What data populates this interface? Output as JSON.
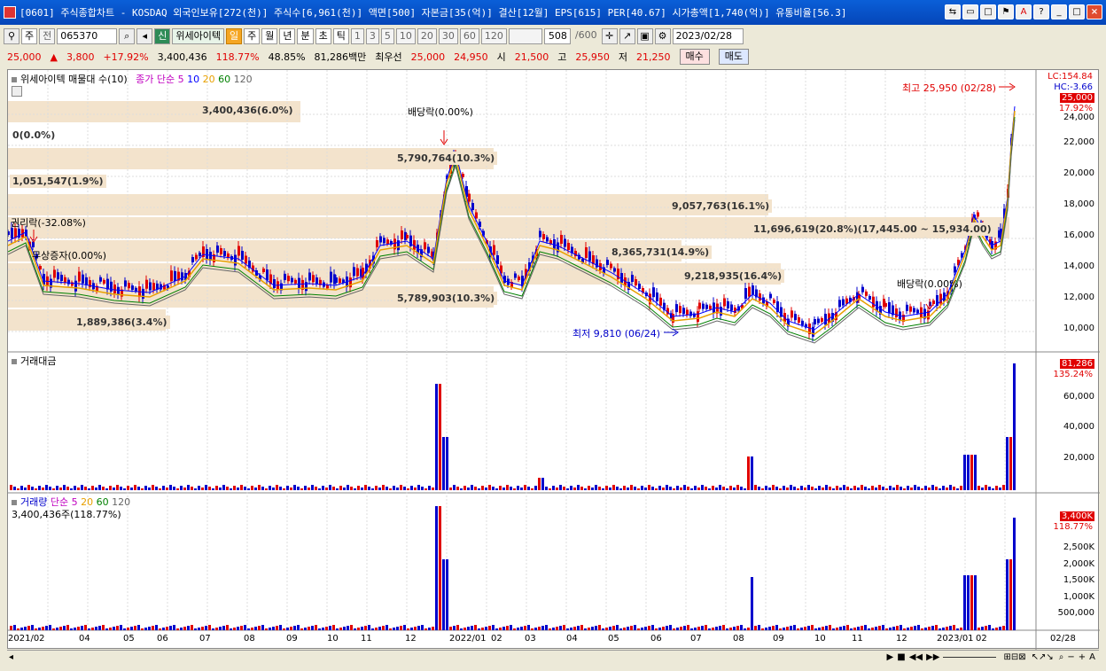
{
  "window": {
    "title": "[0601] 주식종합차트 - KOSDAQ 외국인보유[272(천)] 주식수[6,961(천)] 액면[500] 자본금[35(억)] 결산[12월] EPS[615] PER[40.67] 시가총액[1,740(억)] 유통비율[56.3]"
  },
  "toolbar": {
    "type_sel": "주",
    "prev_label": "전",
    "code": "065370",
    "new_badge": "신",
    "name": "위세아이텍",
    "periods": [
      "일",
      "주",
      "월",
      "년",
      "분",
      "초",
      "틱"
    ],
    "active_period": "일",
    "minutes": [
      "1",
      "3",
      "5",
      "10",
      "20",
      "30",
      "60",
      "120"
    ],
    "count": "508",
    "count_total": "/600",
    "date": "2023/02/28"
  },
  "quote": {
    "price": "25,000",
    "change": "3,800",
    "change_pct": "+17.92%",
    "volume": "3,400,436",
    "vol_ratio": "118.77%",
    "turnover": "48.85%",
    "amount": "81,286백만",
    "best_bid_label": "최우선",
    "best_ask": "25,000",
    "best_bid": "24,950",
    "open_label": "시",
    "open": "21,500",
    "high_label": "고",
    "high": "25,950",
    "low_label": "저",
    "low": "21,250",
    "buy_label": "매수",
    "sell_label": "매도"
  },
  "main_panel": {
    "legend_name": "위세아이텍 매물대 수(10)",
    "legend_ma_label": "종가 단순",
    "ma_periods": [
      "5",
      "10",
      "20",
      "60",
      "120"
    ],
    "lc": "LC:154.84",
    "hc": "HC:-3.66",
    "price_tag": "25,000",
    "pct_tag": "17.92%",
    "high_note": "최고 25,950 (02/28)",
    "low_note": "최저 9,810 (06/24)",
    "dividend1": "배당락(0.00%)",
    "dividend2": "배당락(0.00%)",
    "rights_label": "권리락(-32.08%)",
    "bonus_label": "무상증자(0.00%)",
    "volume_profile": [
      "3,400,436(6.0%)",
      "0(0.0%)",
      "5,790,764(10.3%)",
      "1,051,547(1.9%)",
      "9,057,763(16.1%)",
      "11,696,619(20.8%)(17,445.00 ~ 15,934.00)",
      "8,365,731(14.9%)",
      "9,218,935(16.4%)",
      "5,789,903(10.3%)",
      "1,889,386(3.4%)"
    ],
    "y_ticks": [
      "24,000",
      "22,000",
      "20,000",
      "18,000",
      "16,000",
      "14,000",
      "12,000",
      "10,000"
    ]
  },
  "amount_panel": {
    "title": "거래대금",
    "value_tag": "81,286",
    "pct_tag": "135.24%",
    "y_ticks": [
      "60,000",
      "40,000",
      "20,000"
    ]
  },
  "volume_panel": {
    "title": "거래량",
    "ma_label": "단순",
    "ma_periods": [
      "5",
      "20",
      "60",
      "120"
    ],
    "sub": "3,400,436주(118.77%)",
    "value_tag": "3,400K",
    "pct_tag": "118.77%",
    "y_ticks": [
      "2,500K",
      "2,000K",
      "1,500K",
      "1,000K",
      "500,000"
    ]
  },
  "x_axis": [
    "2021/02",
    "04",
    "05",
    "06",
    "07",
    "08",
    "09",
    "10",
    "11",
    "12",
    "2022/01",
    "02",
    "03",
    "04",
    "05",
    "06",
    "07",
    "08",
    "09",
    "10",
    "11",
    "12",
    "2023/01",
    "02",
    "02/28"
  ],
  "colors": {
    "up": "#e00000",
    "down": "#0000cc",
    "ma5": "#ff00ff",
    "ma10": "#0000ff",
    "ma20": "#e8a000",
    "ma60": "#008000",
    "ma120": "#666666"
  }
}
